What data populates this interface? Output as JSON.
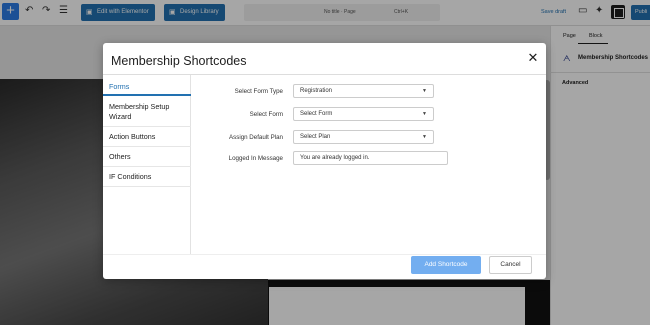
{
  "toolbar": {
    "plus_icon": "plus-icon",
    "undo_icon": "undo-icon",
    "redo_icon": "redo-icon",
    "list_view_icon": "list-view-icon",
    "edit_with_elementor": "Edit with Elementor",
    "design_library": "Design Library",
    "document_title": "No title · Page",
    "shortcut": "Ctrl+K",
    "save_draft": "Save draft",
    "publish": "Publi"
  },
  "sidebar": {
    "tabs": [
      "Page",
      "Block"
    ],
    "active_tab": "Block",
    "block_name": "Membership Shortcodes",
    "advanced": "Advanced"
  },
  "modal": {
    "title": "Membership Shortcodes",
    "close_glyph": "✕",
    "nav": [
      {
        "label": "Forms",
        "active": true
      },
      {
        "label": "Membership Setup Wizard",
        "active": false
      },
      {
        "label": "Action Buttons",
        "active": false
      },
      {
        "label": "Others",
        "active": false
      },
      {
        "label": "IF Conditions",
        "active": false
      }
    ],
    "fields": {
      "form_type": {
        "label": "Select Form Type",
        "value": "Registration"
      },
      "form": {
        "label": "Select Form",
        "value": "Select Form"
      },
      "default_plan": {
        "label": "Assign Default Plan",
        "value": "Select Plan"
      },
      "logged_in_message": {
        "label": "Logged In Message",
        "value": "You are already logged in."
      }
    },
    "add_shortcode": "Add Shortcode",
    "cancel": "Cancel"
  },
  "colors": {
    "accent": "#2271b1",
    "add_button": "#73aef0",
    "overlay": "rgba(0,0,0,0.35)"
  }
}
